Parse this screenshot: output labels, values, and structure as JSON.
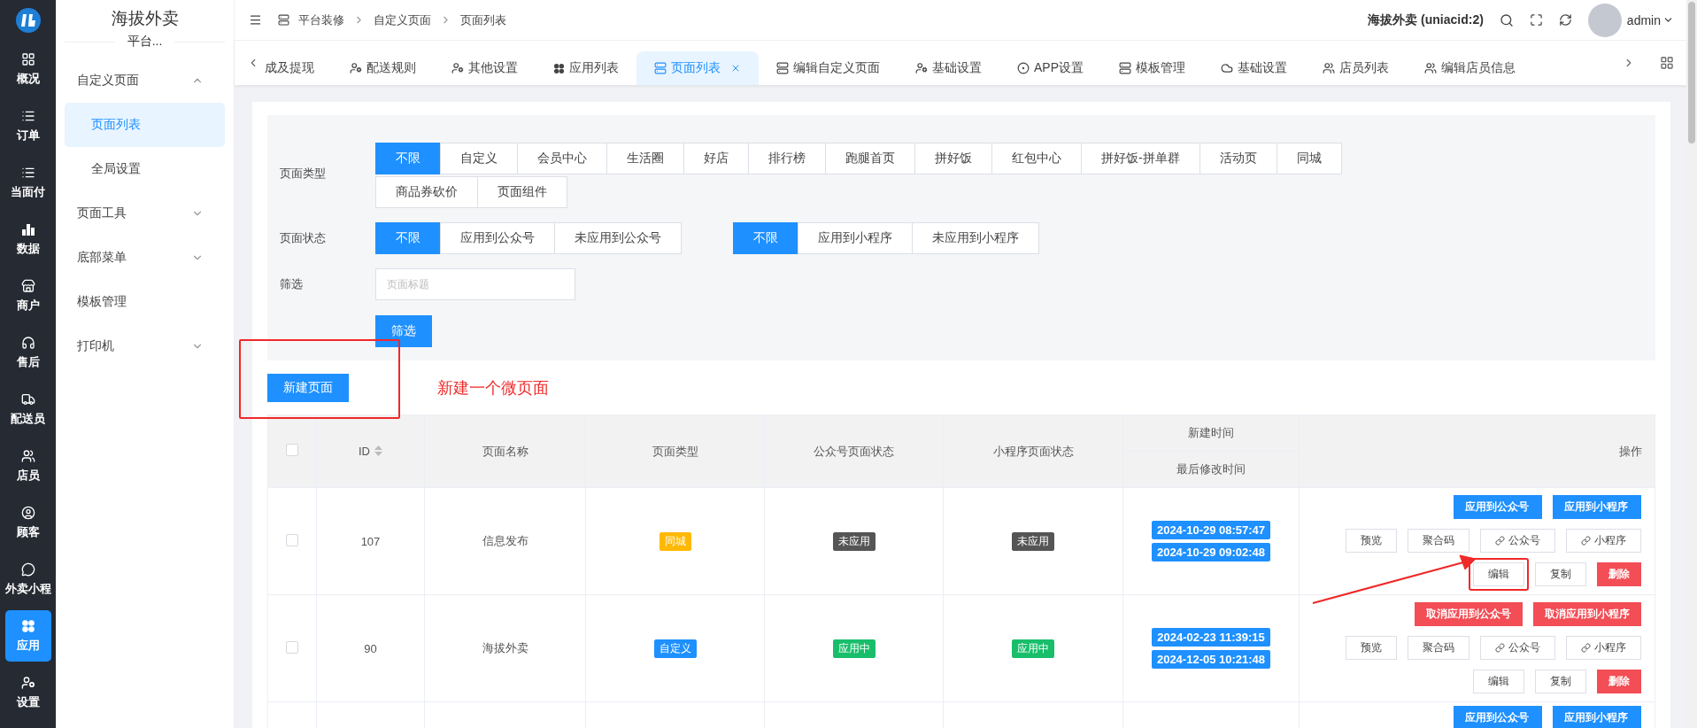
{
  "nav": [
    {
      "label": "概况",
      "selected": false
    },
    {
      "label": "订单",
      "selected": false
    },
    {
      "label": "当面付",
      "selected": false
    },
    {
      "label": "数据",
      "selected": false
    },
    {
      "label": "商户",
      "selected": false
    },
    {
      "label": "售后",
      "selected": false
    },
    {
      "label": "配送员",
      "selected": false
    },
    {
      "label": "店员",
      "selected": false
    },
    {
      "label": "顾客",
      "selected": false
    },
    {
      "label": "外卖小程",
      "selected": false
    },
    {
      "label": "应用",
      "selected": true
    },
    {
      "label": "设置",
      "selected": false
    }
  ],
  "submenu": {
    "title": "海拔外卖",
    "subtitle": "平台...",
    "items": [
      {
        "kind": "group",
        "label": "自定义页面",
        "expanded": true,
        "children": [
          {
            "label": "页面列表",
            "selected": true
          },
          {
            "label": "全局设置",
            "selected": false
          }
        ]
      },
      {
        "kind": "group",
        "label": "页面工具",
        "expanded": false
      },
      {
        "kind": "group",
        "label": "底部菜单",
        "expanded": false
      },
      {
        "kind": "link",
        "label": "模板管理"
      },
      {
        "kind": "group",
        "label": "打印机",
        "expanded": false
      }
    ]
  },
  "breadcrumb": [
    "平台装修",
    "自定义页面",
    "页面列表"
  ],
  "account": {
    "shop": "海拔外卖 (uniacid:2)",
    "user": "admin"
  },
  "tabs": [
    {
      "label": "成及提现",
      "selected": false
    },
    {
      "label": "配送规则",
      "selected": false
    },
    {
      "label": "其他设置",
      "selected": false
    },
    {
      "label": "应用列表",
      "selected": false
    },
    {
      "label": "页面列表",
      "selected": true
    },
    {
      "label": "编辑自定义页面",
      "selected": false
    },
    {
      "label": "基础设置",
      "selected": false
    },
    {
      "label": "APP设置",
      "selected": false
    },
    {
      "label": "模板管理",
      "selected": false
    },
    {
      "label": "基础设置",
      "selected": false
    },
    {
      "label": "店员列表",
      "selected": false
    },
    {
      "label": "编辑店员信息",
      "selected": false
    }
  ],
  "filters": {
    "type": {
      "label": "页面类型",
      "options": [
        {
          "label": "不限",
          "selected": true
        },
        {
          "label": "自定义",
          "selected": false
        },
        {
          "label": "会员中心",
          "selected": false
        },
        {
          "label": "生活圈",
          "selected": false
        },
        {
          "label": "好店",
          "selected": false
        },
        {
          "label": "排行榜",
          "selected": false
        },
        {
          "label": "跑腿首页",
          "selected": false
        },
        {
          "label": "拼好饭",
          "selected": false
        },
        {
          "label": "红包中心",
          "selected": false
        },
        {
          "label": "拼好饭-拼单群",
          "selected": false
        },
        {
          "label": "活动页",
          "selected": false
        },
        {
          "label": "同城",
          "selected": false
        },
        {
          "label": "商品券砍价",
          "selected": false
        },
        {
          "label": "页面组件",
          "selected": false
        }
      ]
    },
    "status": {
      "label": "页面状态",
      "groups": [
        [
          {
            "label": "不限",
            "selected": true
          },
          {
            "label": "应用到公众号",
            "selected": false
          },
          {
            "label": "未应用到公众号",
            "selected": false
          }
        ],
        [
          {
            "label": "不限",
            "selected": true
          },
          {
            "label": "应用到小程序",
            "selected": false
          },
          {
            "label": "未应用到小程序",
            "selected": false
          }
        ]
      ]
    },
    "search": {
      "label": "筛选",
      "placeholder": "页面标题"
    },
    "submit": "筛选"
  },
  "new_button": "新建页面",
  "annotation": "新建一个微页面",
  "table": {
    "select_all": {
      "checked": false
    },
    "columns": {
      "id": "ID",
      "name": "页面名称",
      "type": "页面类型",
      "mp_status": "公众号页面状态",
      "app_status": "小程序页面状态",
      "created": "新建时间",
      "modified": "最后修改时间",
      "actions": "操作"
    },
    "rows": [
      {
        "checked": false,
        "id": "107",
        "name": "信息发布",
        "type": {
          "label": "同城",
          "color": "#ffb800"
        },
        "mp_status": {
          "label": "未应用",
          "color": "#555555"
        },
        "app_status": {
          "label": "未应用",
          "color": "#555555"
        },
        "created": "2024-10-29 08:57:47",
        "modified": "2024-10-29 09:02:48",
        "actions": [
          [
            {
              "label": "应用到公众号",
              "kind": "primary"
            },
            {
              "label": "应用到小程序",
              "kind": "primary"
            }
          ],
          [
            {
              "label": "预览",
              "kind": "plain"
            },
            {
              "label": "聚合码",
              "kind": "plain"
            },
            {
              "label": "公众号",
              "kind": "link"
            },
            {
              "label": "小程序",
              "kind": "link"
            }
          ],
          [
            {
              "label": "编辑",
              "kind": "plain",
              "highlighted": true
            },
            {
              "label": "复制",
              "kind": "plain"
            },
            {
              "label": "删除",
              "kind": "danger"
            }
          ]
        ]
      },
      {
        "checked": false,
        "id": "90",
        "name": "海拔外卖",
        "type": {
          "label": "自定义",
          "color": "#1e90ff"
        },
        "mp_status": {
          "label": "应用中",
          "color": "#19be6b"
        },
        "app_status": {
          "label": "应用中",
          "color": "#19be6b"
        },
        "created": "2024-02-23 11:39:15",
        "modified": "2024-12-05 10:21:48",
        "actions": [
          [
            {
              "label": "取消应用到公众号",
              "kind": "danger"
            },
            {
              "label": "取消应用到小程序",
              "kind": "danger"
            }
          ],
          [
            {
              "label": "预览",
              "kind": "plain"
            },
            {
              "label": "聚合码",
              "kind": "plain"
            },
            {
              "label": "公众号",
              "kind": "link"
            },
            {
              "label": "小程序",
              "kind": "link"
            }
          ],
          [
            {
              "label": "编辑",
              "kind": "plain"
            },
            {
              "label": "复制",
              "kind": "plain"
            },
            {
              "label": "删除",
              "kind": "danger"
            }
          ]
        ]
      },
      {
        "actions": [
          [
            {
              "label": "应用到公众号",
              "kind": "primary"
            },
            {
              "label": "应用到小程序",
              "kind": "primary"
            }
          ]
        ]
      }
    ]
  }
}
